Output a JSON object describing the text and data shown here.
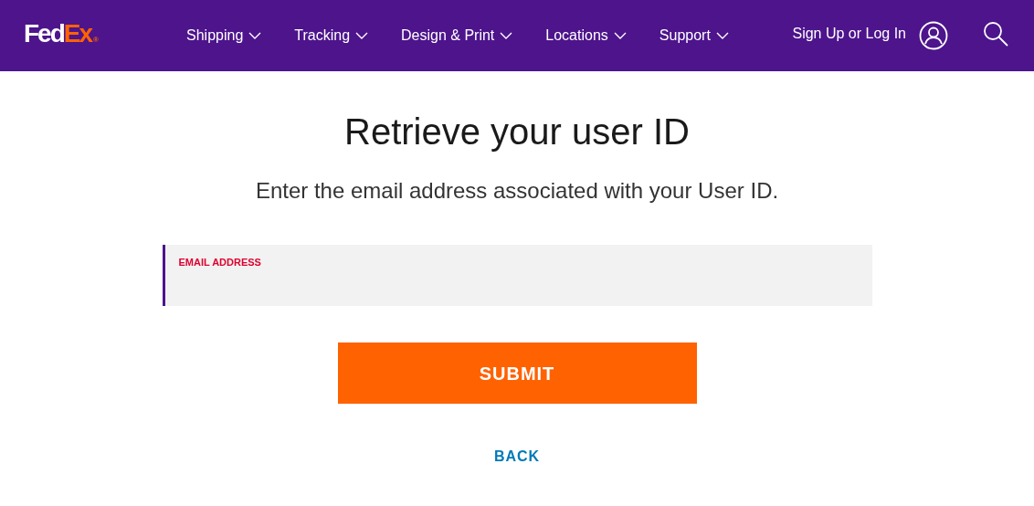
{
  "header": {
    "logo": {
      "part_1": "Fed",
      "part_2": "Ex",
      "mark": "®"
    },
    "nav": [
      {
        "label": "Shipping"
      },
      {
        "label": "Tracking"
      },
      {
        "label": "Design & Print"
      },
      {
        "label": "Locations"
      },
      {
        "label": "Support"
      }
    ],
    "sign_in": "Sign Up or Log In"
  },
  "title": "Retrieve your user ID",
  "subtitle": "Enter the email address associated with your User ID.",
  "email_field": {
    "label": "EMAIL ADDRESS",
    "focused": true
  },
  "submit": "SUBMIT",
  "back": "BACK"
}
